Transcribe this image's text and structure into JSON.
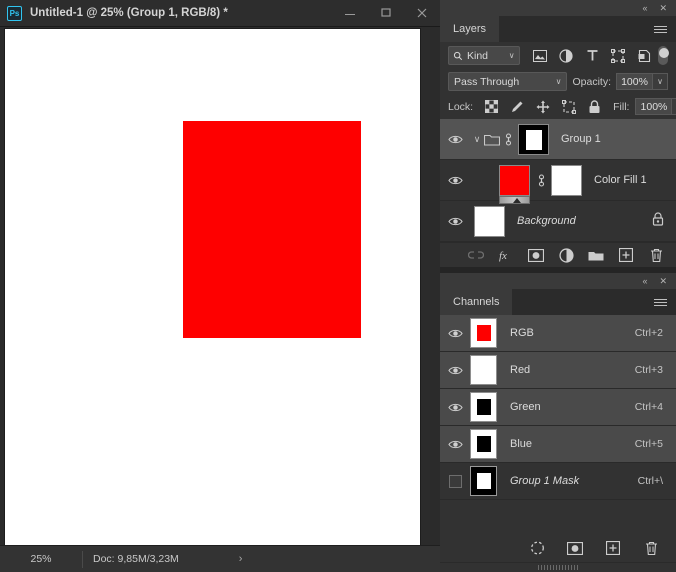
{
  "window": {
    "app_icon": "photoshop-logo-icon",
    "title": "Untitled-1 @ 25% (Group 1, RGB/8) *",
    "minimize_label": "–",
    "maximize_label": "□",
    "close_label": "✕"
  },
  "canvas": {
    "background_color": "#ffffff",
    "shape_color": "#fe0000",
    "shape_name": "red-rectangle"
  },
  "statusbar": {
    "zoom": "25%",
    "doc_info": "Doc: 9,85M/3,23M",
    "expand_arrow": "›"
  },
  "layers_panel": {
    "tab_label": "Layers",
    "collapse_icon": "«",
    "close_icon": "✕",
    "menu_icon": "hamburger-menu-icon",
    "filter": {
      "search_icon": "search-icon",
      "kind_label": "Kind",
      "chevron": "∨",
      "icons": [
        "pixel-layer-filter-icon",
        "adjustment-layer-filter-icon",
        "type-layer-filter-icon",
        "shape-layer-filter-icon",
        "smart-object-filter-icon"
      ],
      "toggle_name": "filter-enable-toggle"
    },
    "blend": {
      "mode": "Pass Through",
      "chevron": "∨",
      "opacity_label": "Opacity:",
      "opacity_value": "100%"
    },
    "lock": {
      "label": "Lock:",
      "icons": [
        "lock-transparency-icon",
        "lock-image-pixels-icon",
        "lock-position-icon",
        "lock-artboard-nesting-icon",
        "lock-all-icon"
      ],
      "fill_label": "Fill:",
      "fill_value": "100%"
    },
    "rows": [
      {
        "name": "Group 1",
        "visible": true,
        "selected": true,
        "kind": "group",
        "disclosure": "∨",
        "has_link": true,
        "thumb": "black-mask-with-white-rect",
        "italic": false,
        "locked": false
      },
      {
        "name": "Color Fill 1",
        "visible": true,
        "selected": false,
        "kind": "fill",
        "has_link": true,
        "thumb": "red-fill-thumbnail",
        "mask_thumb": "white-mask-thumbnail",
        "italic": false,
        "locked": false
      },
      {
        "name": "Background",
        "visible": true,
        "selected": false,
        "kind": "background",
        "has_link": false,
        "thumb": "white-thumbnail",
        "italic": true,
        "locked": true,
        "lock_icon": "padlock-icon"
      }
    ],
    "footer_icons": [
      "link-layers-icon",
      "layer-style-fx-icon",
      "add-layer-mask-icon",
      "new-adjustment-layer-icon",
      "new-group-icon",
      "new-layer-icon",
      "delete-layer-icon"
    ]
  },
  "channels_panel": {
    "tab_label": "Channels",
    "collapse_icon": "«",
    "close_icon": "✕",
    "menu_icon": "hamburger-menu-icon",
    "rows": [
      {
        "name": "RGB",
        "shortcut": "Ctrl+2",
        "visible": true,
        "selected": true,
        "thumb": "rgb-composite-thumbnail",
        "italic": false
      },
      {
        "name": "Red",
        "shortcut": "Ctrl+3",
        "visible": true,
        "selected": true,
        "thumb": "red-channel-thumbnail",
        "italic": false
      },
      {
        "name": "Green",
        "shortcut": "Ctrl+4",
        "visible": true,
        "selected": true,
        "thumb": "green-channel-thumbnail",
        "italic": false
      },
      {
        "name": "Blue",
        "shortcut": "Ctrl+5",
        "visible": true,
        "selected": true,
        "thumb": "blue-channel-thumbnail",
        "italic": false
      },
      {
        "name": "Group 1 Mask",
        "shortcut": "Ctrl+\\",
        "visible": false,
        "selected": false,
        "thumb": "group-mask-thumbnail",
        "italic": true
      }
    ],
    "footer_icons": [
      "load-channel-as-selection-icon",
      "save-selection-as-channel-icon",
      "new-channel-icon",
      "delete-channel-icon"
    ]
  }
}
